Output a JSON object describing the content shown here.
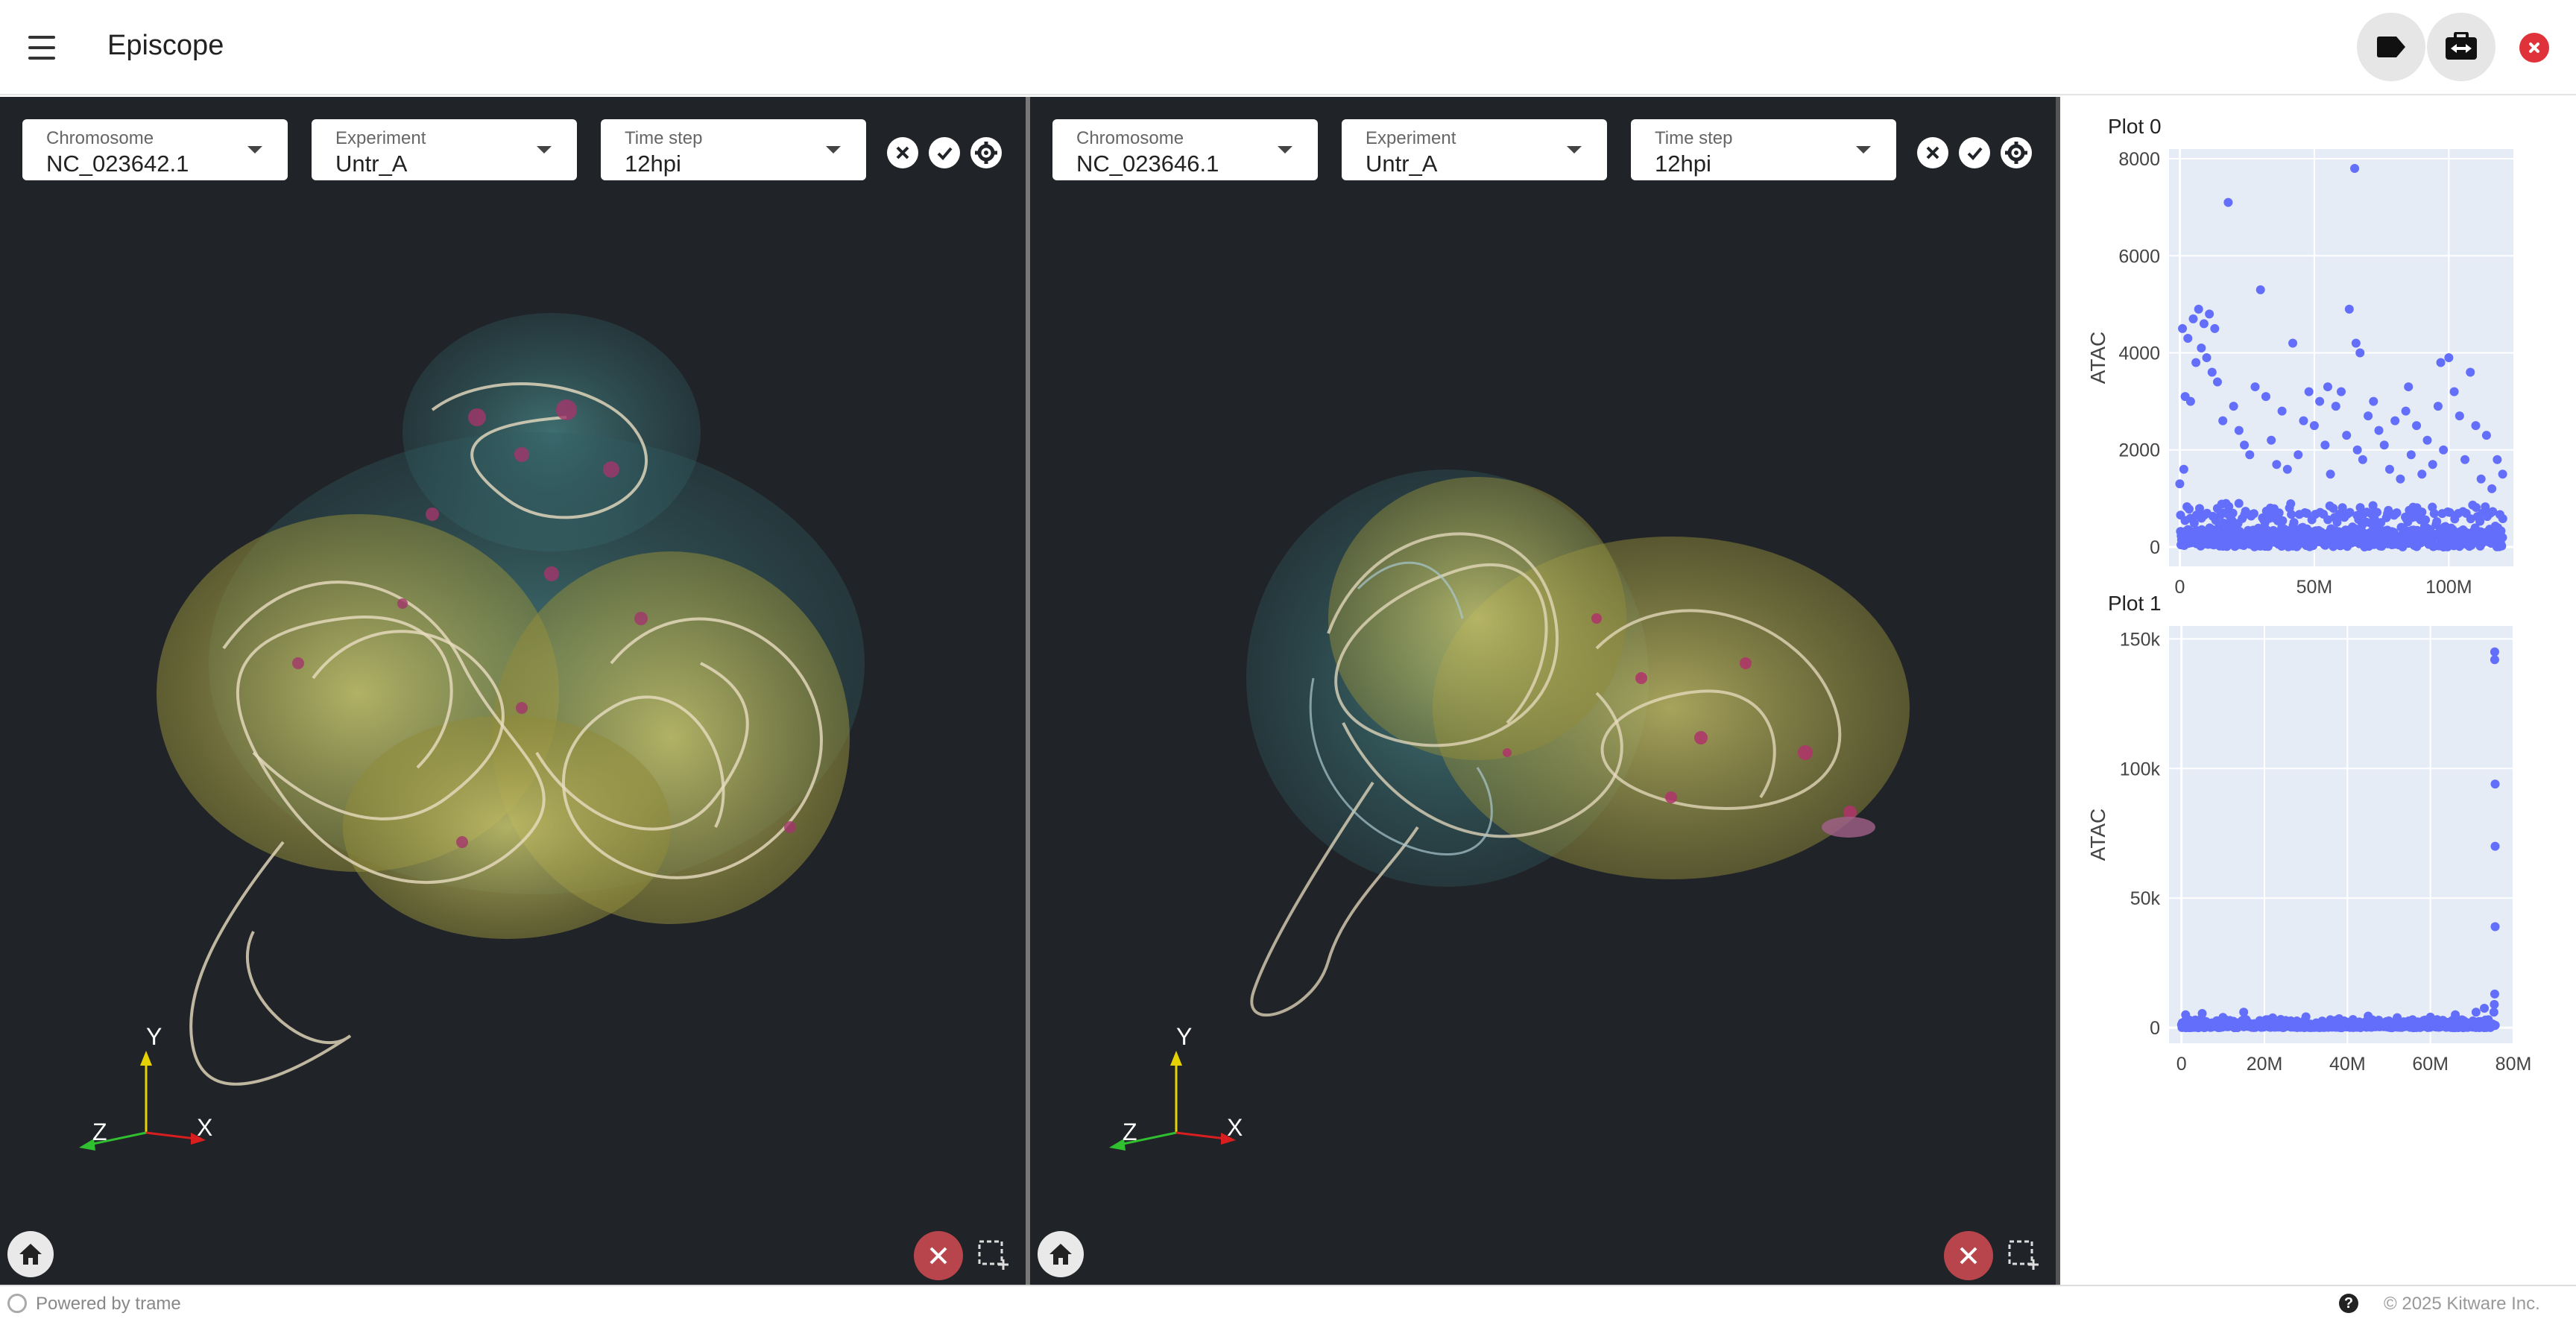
{
  "app": {
    "title": "Episcope"
  },
  "toolbar": {
    "tag_icon": "tag-icon",
    "swap_icon": "swap-icon",
    "close_icon": "close-icon"
  },
  "views": [
    {
      "chromosome": {
        "label": "Chromosome",
        "value": "NC_023642.1"
      },
      "experiment": {
        "label": "Experiment",
        "value": "Untr_A"
      },
      "time_step": {
        "label": "Time step",
        "value": "12hpi"
      },
      "axes": {
        "x": "X",
        "y": "Y",
        "z": "Z"
      }
    },
    {
      "chromosome": {
        "label": "Chromosome",
        "value": "NC_023646.1"
      },
      "experiment": {
        "label": "Experiment",
        "value": "Untr_A"
      },
      "time_step": {
        "label": "Time step",
        "value": "12hpi"
      },
      "axes": {
        "x": "X",
        "y": "Y",
        "z": "Z"
      }
    }
  ],
  "colors": {
    "view_background": "#202327",
    "plot_background": "#e5ecf6",
    "marker": "#636efa",
    "delete_button": "#b8454c",
    "close_app": "#e0323a"
  },
  "chart_data": [
    {
      "type": "scatter",
      "title": "Plot 0",
      "ylabel": "ATAC",
      "xlabel": "",
      "xlim": [
        -4000000,
        124000000
      ],
      "ylim": [
        -400,
        8200
      ],
      "xticks": [
        0,
        50000000,
        100000000
      ],
      "xtick_labels": [
        "0",
        "50M",
        "100M"
      ],
      "yticks": [
        0,
        2000,
        4000,
        6000,
        8000
      ],
      "ytick_labels": [
        "0",
        "2000",
        "4000",
        "6000",
        "8000"
      ],
      "grid": true,
      "legend": false,
      "points": [
        [
          1000000,
          4500
        ],
        [
          3000000,
          4300
        ],
        [
          5000000,
          4700
        ],
        [
          7000000,
          4900
        ],
        [
          9000000,
          4600
        ],
        [
          11000000,
          4800
        ],
        [
          13000000,
          4500
        ],
        [
          6000000,
          3800
        ],
        [
          8000000,
          4100
        ],
        [
          10000000,
          3900
        ],
        [
          18000000,
          7100
        ],
        [
          30000000,
          5300
        ],
        [
          65000000,
          7800
        ],
        [
          63000000,
          4900
        ],
        [
          65500000,
          4200
        ],
        [
          67000000,
          4000
        ],
        [
          42000000,
          4200
        ],
        [
          55000000,
          3300
        ],
        [
          60000000,
          3200
        ],
        [
          85000000,
          3300
        ],
        [
          97000000,
          3800
        ],
        [
          108000000,
          3600
        ],
        [
          100000000,
          3900
        ],
        [
          2000000,
          3100
        ],
        [
          4000000,
          3000
        ],
        [
          12000000,
          3600
        ],
        [
          14000000,
          3400
        ],
        [
          20000000,
          2900
        ],
        [
          28000000,
          3300
        ],
        [
          32000000,
          3100
        ],
        [
          38000000,
          2800
        ],
        [
          46000000,
          2600
        ],
        [
          48000000,
          3200
        ],
        [
          50000000,
          2500
        ],
        [
          52000000,
          3000
        ],
        [
          58000000,
          2900
        ],
        [
          70000000,
          2700
        ],
        [
          72000000,
          3000
        ],
        [
          74000000,
          2400
        ],
        [
          80000000,
          2600
        ],
        [
          84000000,
          2800
        ],
        [
          88000000,
          2500
        ],
        [
          92000000,
          2200
        ],
        [
          96000000,
          2900
        ],
        [
          102000000,
          3200
        ],
        [
          104000000,
          2700
        ],
        [
          110000000,
          2500
        ],
        [
          114000000,
          2300
        ],
        [
          118000000,
          1800
        ],
        [
          120000000,
          1500
        ],
        [
          16000000,
          2600
        ],
        [
          22000000,
          2400
        ],
        [
          24000000,
          2100
        ],
        [
          26000000,
          1900
        ],
        [
          34000000,
          2200
        ],
        [
          36000000,
          1700
        ],
        [
          40000000,
          1600
        ],
        [
          44000000,
          1900
        ],
        [
          54000000,
          2100
        ],
        [
          56000000,
          1500
        ],
        [
          62000000,
          2300
        ],
        [
          66000000,
          2000
        ],
        [
          68000000,
          1800
        ],
        [
          76000000,
          2100
        ],
        [
          78000000,
          1600
        ],
        [
          82000000,
          1400
        ],
        [
          86000000,
          1900
        ],
        [
          90000000,
          1500
        ],
        [
          94000000,
          1700
        ],
        [
          98000000,
          2000
        ],
        [
          106000000,
          1800
        ],
        [
          112000000,
          1400
        ],
        [
          116000000,
          1200
        ],
        [
          0,
          1300
        ],
        [
          1500000,
          1600
        ]
      ],
      "dense_baseline_max": 900
    },
    {
      "type": "scatter",
      "title": "Plot 1",
      "ylabel": "ATAC",
      "xlabel": "",
      "xlim": [
        -3000000,
        80000000
      ],
      "ylim": [
        -6000,
        155000
      ],
      "xticks": [
        0,
        20000000,
        40000000,
        60000000,
        80000000
      ],
      "xtick_labels": [
        "0",
        "20M",
        "40M",
        "60M",
        "80M"
      ],
      "yticks": [
        0,
        50000,
        100000,
        150000
      ],
      "ytick_labels": [
        "0",
        "50k",
        "100k",
        "150k"
      ],
      "grid": true,
      "legend": false,
      "points": [
        [
          75500000,
          145000
        ],
        [
          75500000,
          142000
        ],
        [
          75600000,
          94000
        ],
        [
          75600000,
          70000
        ],
        [
          75600000,
          39000
        ],
        [
          75500000,
          13000
        ],
        [
          75400000,
          9000
        ],
        [
          75300000,
          6000
        ],
        [
          1000000,
          5000
        ],
        [
          5000000,
          5500
        ],
        [
          10000000,
          4000
        ],
        [
          15000000,
          6000
        ],
        [
          22000000,
          3800
        ],
        [
          30000000,
          4200
        ],
        [
          38000000,
          3500
        ],
        [
          45000000,
          4500
        ],
        [
          52000000,
          3900
        ],
        [
          60000000,
          4100
        ],
        [
          66000000,
          5000
        ],
        [
          71000000,
          6000
        ],
        [
          73000000,
          7500
        ]
      ],
      "dense_baseline_max": 3200
    }
  ],
  "footer": {
    "powered": "Powered by trame",
    "help": "?",
    "copyright": "© 2025 Kitware Inc."
  }
}
